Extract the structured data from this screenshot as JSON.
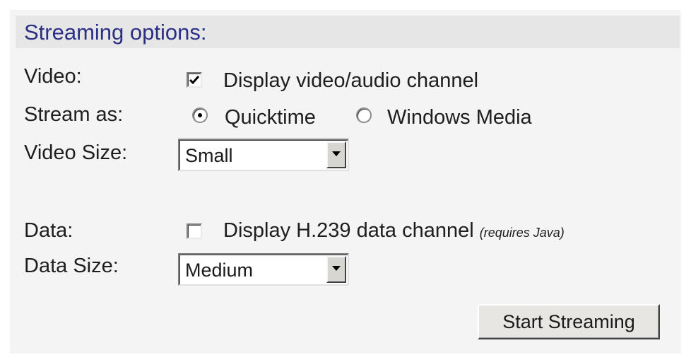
{
  "section": {
    "title": "Streaming options:"
  },
  "video": {
    "label": "Video:",
    "checkbox_label": "Display video/audio channel",
    "checked": true
  },
  "stream_as": {
    "label": "Stream as:",
    "options": [
      "Quicktime",
      "Windows Media"
    ],
    "selected": "Quicktime"
  },
  "video_size": {
    "label": "Video Size:",
    "value": "Small"
  },
  "data": {
    "label": "Data:",
    "checkbox_label": "Display H.239 data channel",
    "note": "(requires Java)",
    "checked": false
  },
  "data_size": {
    "label": "Data Size:",
    "value": "Medium"
  },
  "actions": {
    "start_label": "Start Streaming"
  },
  "colors": {
    "title": "#2c2f86",
    "panel_bg": "#f4f4f4",
    "header_bg": "#e6e6e6"
  }
}
